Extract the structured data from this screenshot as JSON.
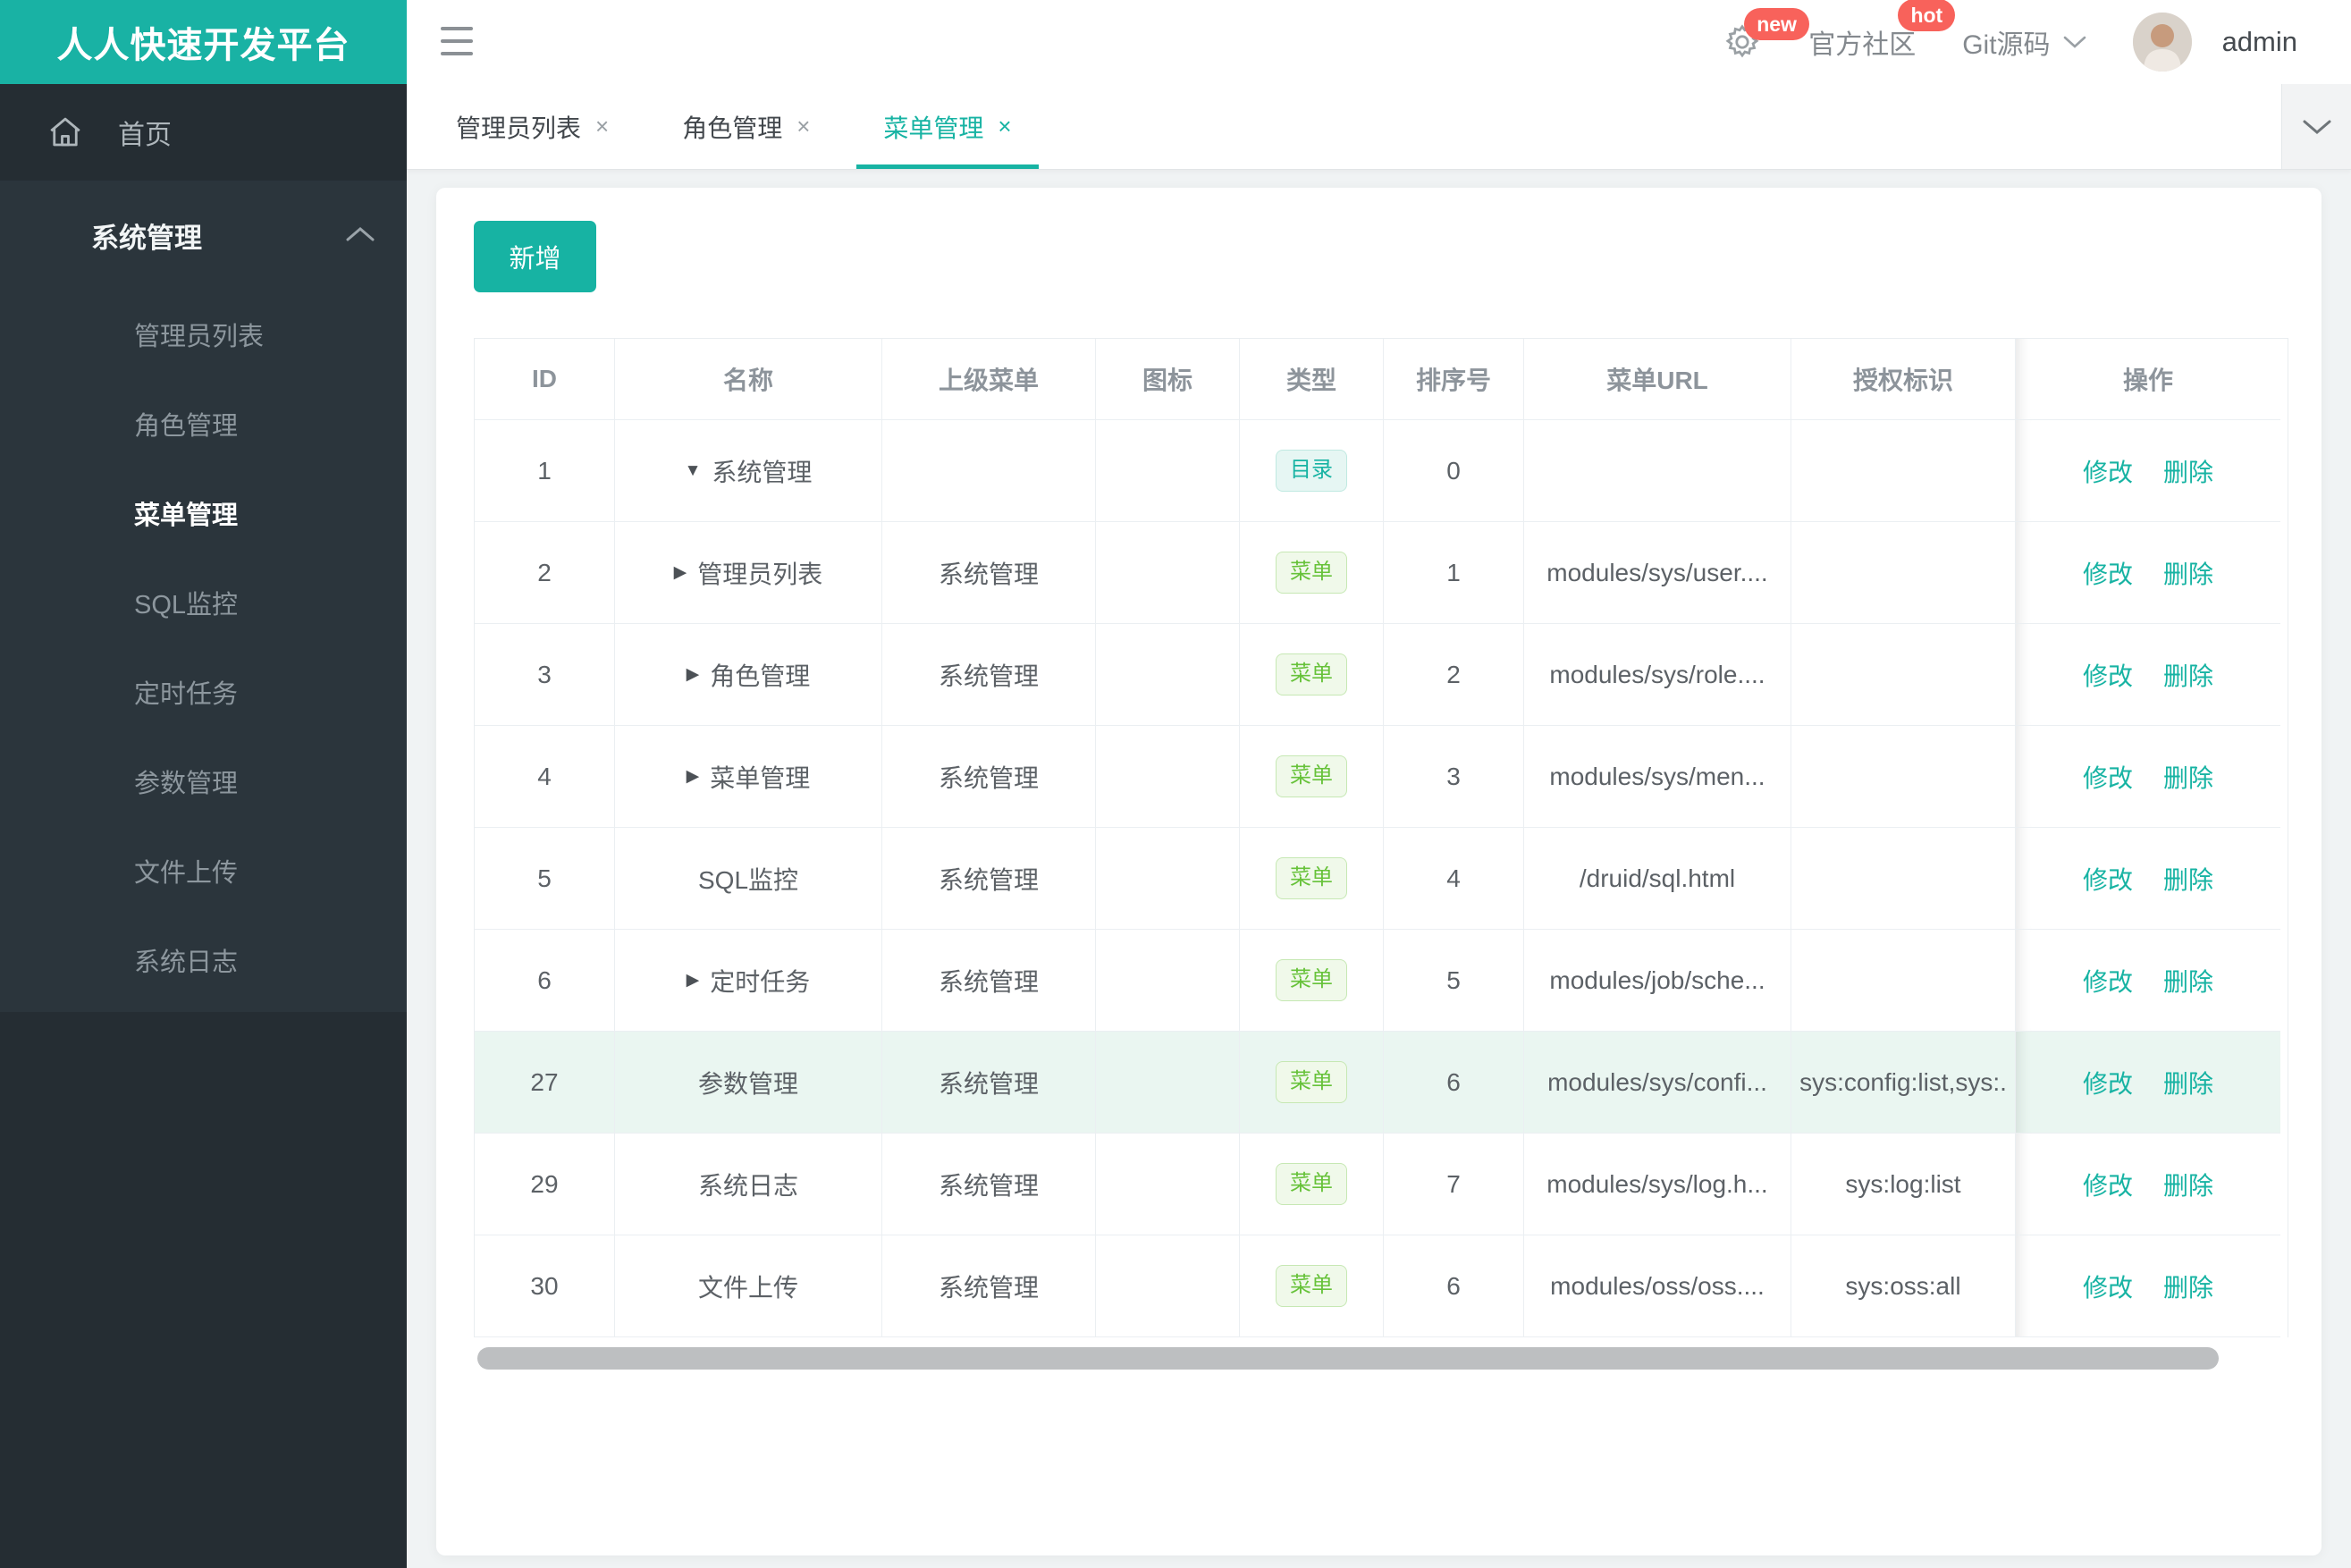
{
  "brand": {
    "logo_text": "人人快速开发平台"
  },
  "topbar": {
    "badge_new": "new",
    "community_label": "官方社区",
    "badge_hot": "hot",
    "git_label": "Git源码",
    "username": "admin"
  },
  "tabs": [
    {
      "label": "管理员列表"
    },
    {
      "label": "角色管理"
    },
    {
      "label": "菜单管理"
    }
  ],
  "ui": {
    "close_glyph": "×",
    "accent_color": "#17b3a3",
    "badge_red": "#f8625b",
    "menu_green": "#67c23a"
  },
  "sidebar": {
    "home_label": "首页",
    "menu": {
      "label": "系统管理",
      "children": [
        {
          "label": "管理员列表"
        },
        {
          "label": "角色管理"
        },
        {
          "label": "菜单管理"
        },
        {
          "label": "SQL监控"
        },
        {
          "label": "定时任务"
        },
        {
          "label": "参数管理"
        },
        {
          "label": "文件上传"
        },
        {
          "label": "系统日志"
        }
      ]
    }
  },
  "toolbar": {
    "add_label": "新增"
  },
  "table": {
    "headers": [
      "ID",
      "名称",
      "上级菜单",
      "图标",
      "类型",
      "排序号",
      "菜单URL",
      "授权标识",
      "操作"
    ],
    "ops": {
      "edit": "修改",
      "delete": "删除"
    },
    "rows": [
      {
        "id": "1",
        "arrow": "▼",
        "name": "系统管理",
        "parent": "",
        "icon": "",
        "type_label": "目录",
        "type_key": "dir",
        "order": "0",
        "url": "",
        "perms": ""
      },
      {
        "id": "2",
        "arrow": "▶",
        "name": "管理员列表",
        "parent": "系统管理",
        "icon": "",
        "type_label": "菜单",
        "type_key": "menu",
        "order": "1",
        "url": "modules/sys/user....",
        "perms": ""
      },
      {
        "id": "3",
        "arrow": "▶",
        "name": "角色管理",
        "parent": "系统管理",
        "icon": "",
        "type_label": "菜单",
        "type_key": "menu",
        "order": "2",
        "url": "modules/sys/role....",
        "perms": ""
      },
      {
        "id": "4",
        "arrow": "▶",
        "name": "菜单管理",
        "parent": "系统管理",
        "icon": "",
        "type_label": "菜单",
        "type_key": "menu",
        "order": "3",
        "url": "modules/sys/men...",
        "perms": ""
      },
      {
        "id": "5",
        "arrow": "",
        "name": "SQL监控",
        "parent": "系统管理",
        "icon": "",
        "type_label": "菜单",
        "type_key": "menu",
        "order": "4",
        "url": "/druid/sql.html",
        "perms": ""
      },
      {
        "id": "6",
        "arrow": "▶",
        "name": "定时任务",
        "parent": "系统管理",
        "icon": "",
        "type_label": "菜单",
        "type_key": "menu",
        "order": "5",
        "url": "modules/job/sche...",
        "perms": ""
      },
      {
        "id": "27",
        "arrow": "",
        "name": "参数管理",
        "parent": "系统管理",
        "icon": "",
        "type_label": "菜单",
        "type_key": "menu",
        "order": "6",
        "url": "modules/sys/confi...",
        "perms": "sys:config:list,sys:."
      },
      {
        "id": "29",
        "arrow": "",
        "name": "系统日志",
        "parent": "系统管理",
        "icon": "",
        "type_label": "菜单",
        "type_key": "menu",
        "order": "7",
        "url": "modules/sys/log.h...",
        "perms": "sys:log:list"
      },
      {
        "id": "30",
        "arrow": "",
        "name": "文件上传",
        "parent": "系统管理",
        "icon": "",
        "type_label": "菜单",
        "type_key": "menu",
        "order": "6",
        "url": "modules/oss/oss....",
        "perms": "sys:oss:all"
      }
    ]
  }
}
